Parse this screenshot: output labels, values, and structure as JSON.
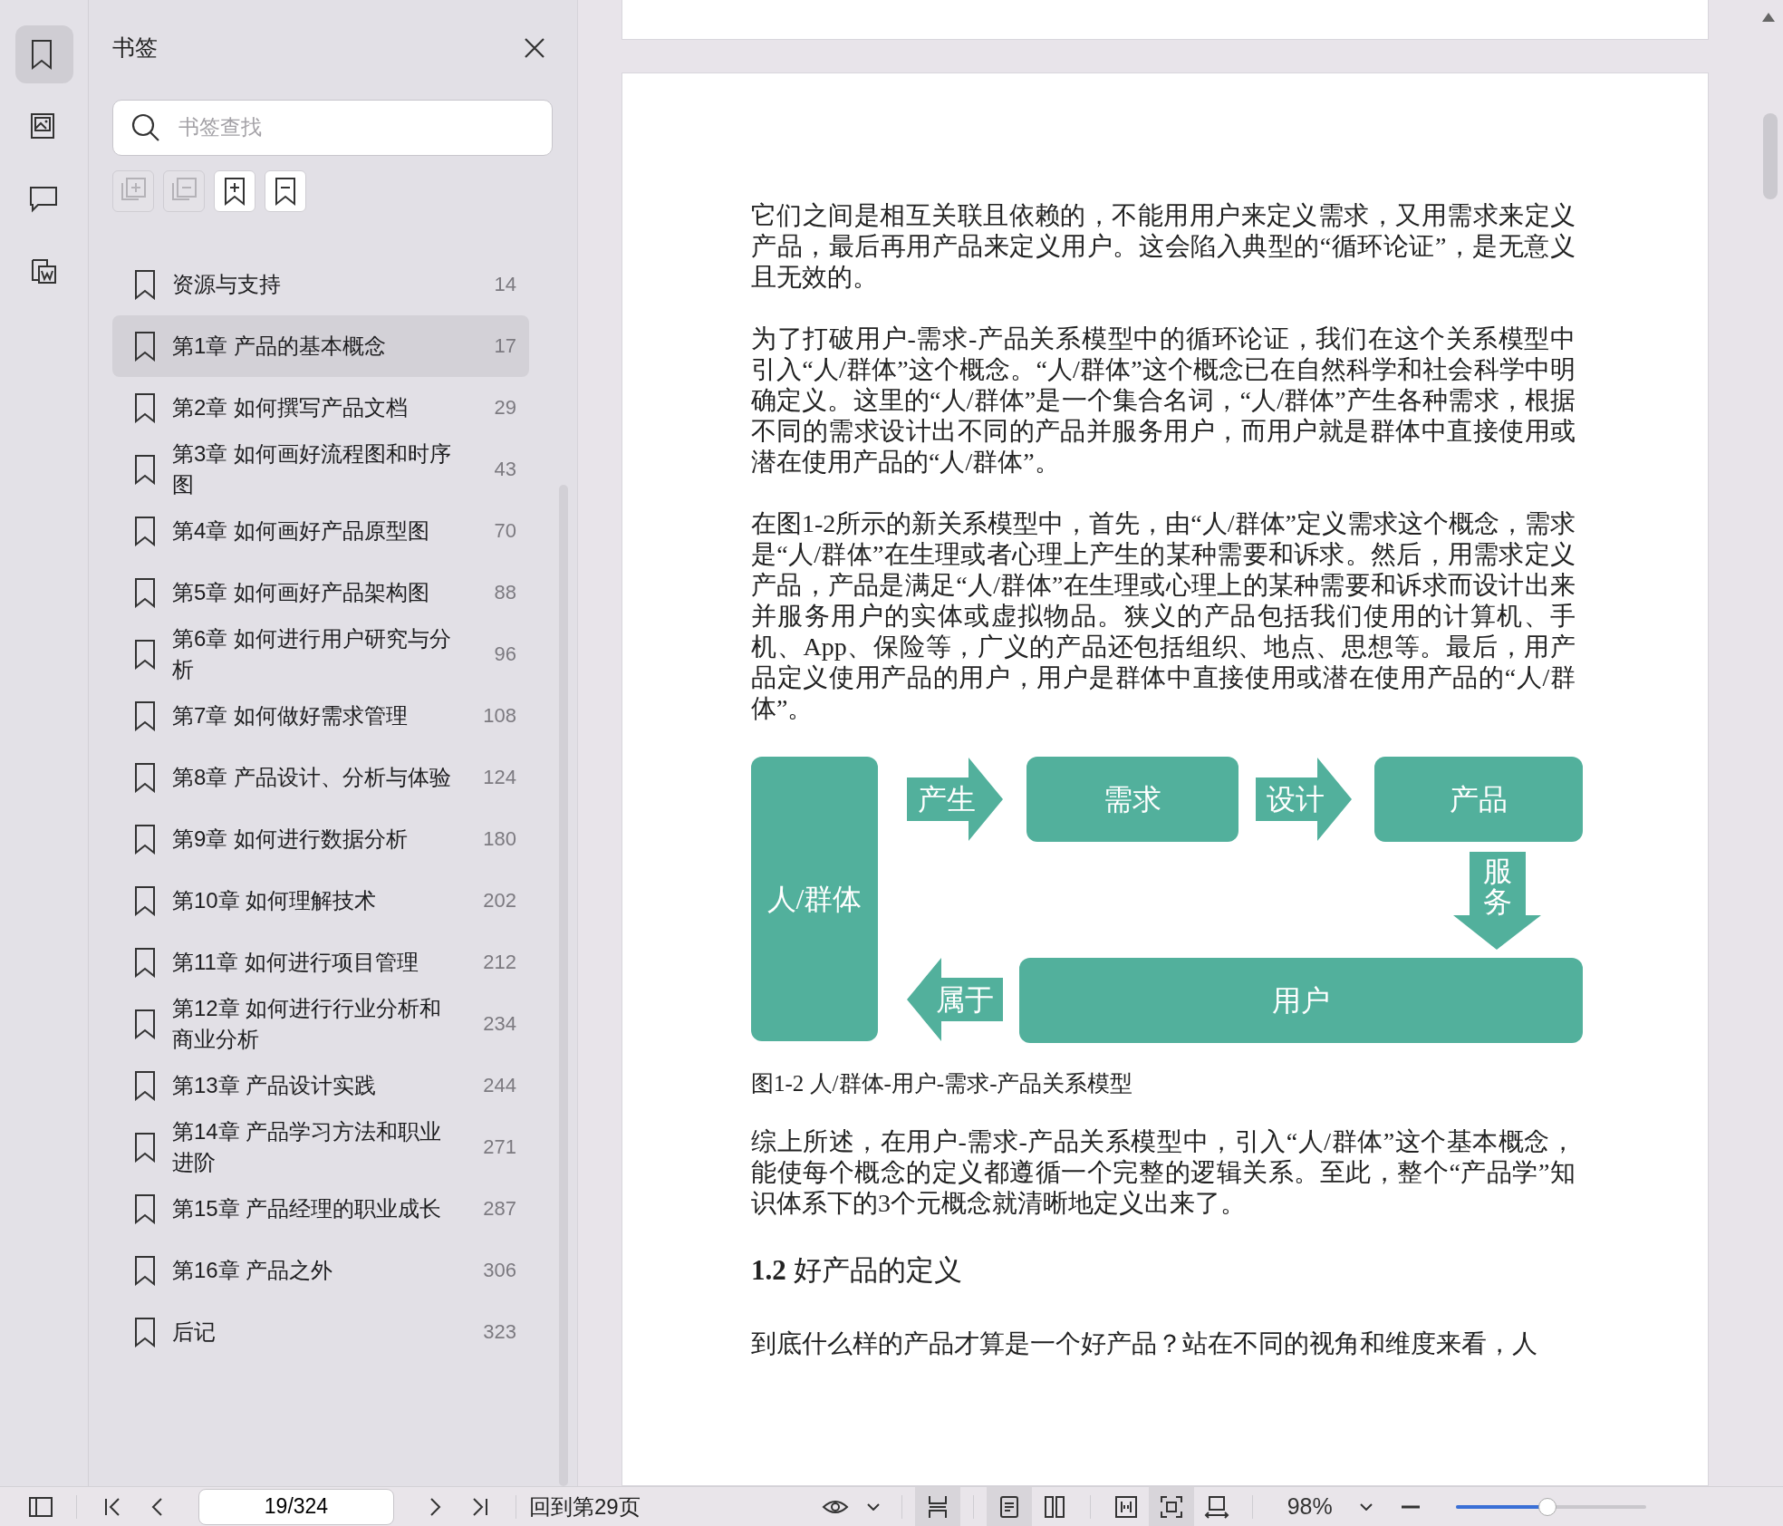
{
  "rail": [
    {
      "kind": "bookmarks",
      "selected": true
    },
    {
      "kind": "thumbnails",
      "selected": false
    },
    {
      "kind": "comments",
      "selected": false
    },
    {
      "kind": "export",
      "selected": false
    }
  ],
  "sidebar": {
    "title": "书签",
    "search": {
      "placeholder": "书签查找"
    },
    "tools": [
      {
        "kind": "expand",
        "disabled": true
      },
      {
        "kind": "collapse",
        "disabled": true
      },
      {
        "kind": "add",
        "disabled": false
      },
      {
        "kind": "remove",
        "disabled": false
      }
    ],
    "bookmarks": [
      {
        "label": "资源与支持",
        "page": "14",
        "selected": false
      },
      {
        "label": "第1章 产品的基本概念",
        "page": "17",
        "selected": true
      },
      {
        "label": "第2章 如何撰写产品文档",
        "page": "29",
        "selected": false
      },
      {
        "label": "第3章 如何画好流程图和时序图",
        "page": "43",
        "selected": false
      },
      {
        "label": "第4章 如何画好产品原型图",
        "page": "70",
        "selected": false
      },
      {
        "label": "第5章 如何画好产品架构图",
        "page": "88",
        "selected": false
      },
      {
        "label": "第6章 如何进行用户研究与分析",
        "page": "96",
        "selected": false
      },
      {
        "label": "第7章 如何做好需求管理",
        "page": "108",
        "selected": false
      },
      {
        "label": "第8章 产品设计、分析与体验",
        "page": "124",
        "selected": false
      },
      {
        "label": "第9章 如何进行数据分析",
        "page": "180",
        "selected": false
      },
      {
        "label": "第10章 如何理解技术",
        "page": "202",
        "selected": false
      },
      {
        "label": "第11章 如何进行项目管理",
        "page": "212",
        "selected": false
      },
      {
        "label": "第12章 如何进行行业分析和商业分析",
        "page": "234",
        "selected": false
      },
      {
        "label": "第13章 产品设计实践",
        "page": "244",
        "selected": false
      },
      {
        "label": "第14章 产品学习方法和职业进阶",
        "page": "271",
        "selected": false
      },
      {
        "label": "第15章 产品经理的职业成长",
        "page": "287",
        "selected": false
      },
      {
        "label": "第16章 产品之外",
        "page": "306",
        "selected": false
      },
      {
        "label": "后记",
        "page": "323",
        "selected": false
      }
    ]
  },
  "document": {
    "paragraphs": [
      "它们之间是相互关联且依赖的，不能用用户来定义需求，又用需求来定义产品，最后再用产品来定义用户。这会陷入典型的“循环论证”，是无意义且无效的。",
      "为了打破用户-需求-产品关系模型中的循环论证，我们在这个关系模型中引入“人/群体”这个概念。“人/群体”这个概念已在自然科学和社会科学中明确定义。这里的“人/群体”是一个集合名词，“人/群体”产生各种需求，根据不同的需求设计出不同的产品并服务用户，而用户就是群体中直接使用或潜在使用产品的“人/群体”。",
      "在图1-2所示的新关系模型中，首先，由“人/群体”定义需求这个概念，需求是“人/群体”在生理或者心理上产生的某种需要和诉求。然后，用需求定义产品，产品是满足“人/群体”在生理或心理上的某种需要和诉求而设计出来并服务用户的实体或虚拟物品。狭义的产品包括我们使用的计算机、手机、App、保险等，广义的产品还包括组织、地点、思想等。最后，用产品定义使用产品的用户，用户是群体中直接使用或潜在使用产品的“人/群体”。"
    ],
    "figure": {
      "group": "人/群体",
      "need": "需求",
      "product": "产品",
      "user": "用户",
      "arrows": [
        {
          "label": "产生",
          "kind": "right"
        },
        {
          "label": "设计",
          "kind": "right"
        },
        {
          "label": "服务",
          "kind": "down"
        },
        {
          "label": "属于",
          "kind": "left"
        }
      ],
      "caption": "图1-2 人/群体-用户-需求-产品关系模型"
    },
    "after_figure": "综上所述，在用户-需求-产品关系模型中，引入“人/群体”这个基本概念，能使每个概念的定义都遵循一个完整的逻辑关系。至此，整个“产品学”知识体系下的3个元概念就清晰地定义出来了。",
    "heading": "**1.2** 好产品的定义",
    "last_paragraph": "到底什么样的产品才算是一个好产品？站在不同的视角和维度来看，人"
  },
  "toolbar": {
    "page_field": "19/324",
    "back_link": "回到第29页",
    "view_modes": [
      {
        "kind": "continuous",
        "selected": true
      },
      {
        "kind": "single",
        "selected": true
      },
      {
        "kind": "double",
        "selected": false
      },
      {
        "kind": "fitwidth",
        "selected": false
      },
      {
        "kind": "fitpage",
        "selected": true
      },
      {
        "kind": "actual",
        "selected": false
      }
    ],
    "zoom": "98%",
    "zoom_slider": {
      "level": 0.48
    }
  }
}
